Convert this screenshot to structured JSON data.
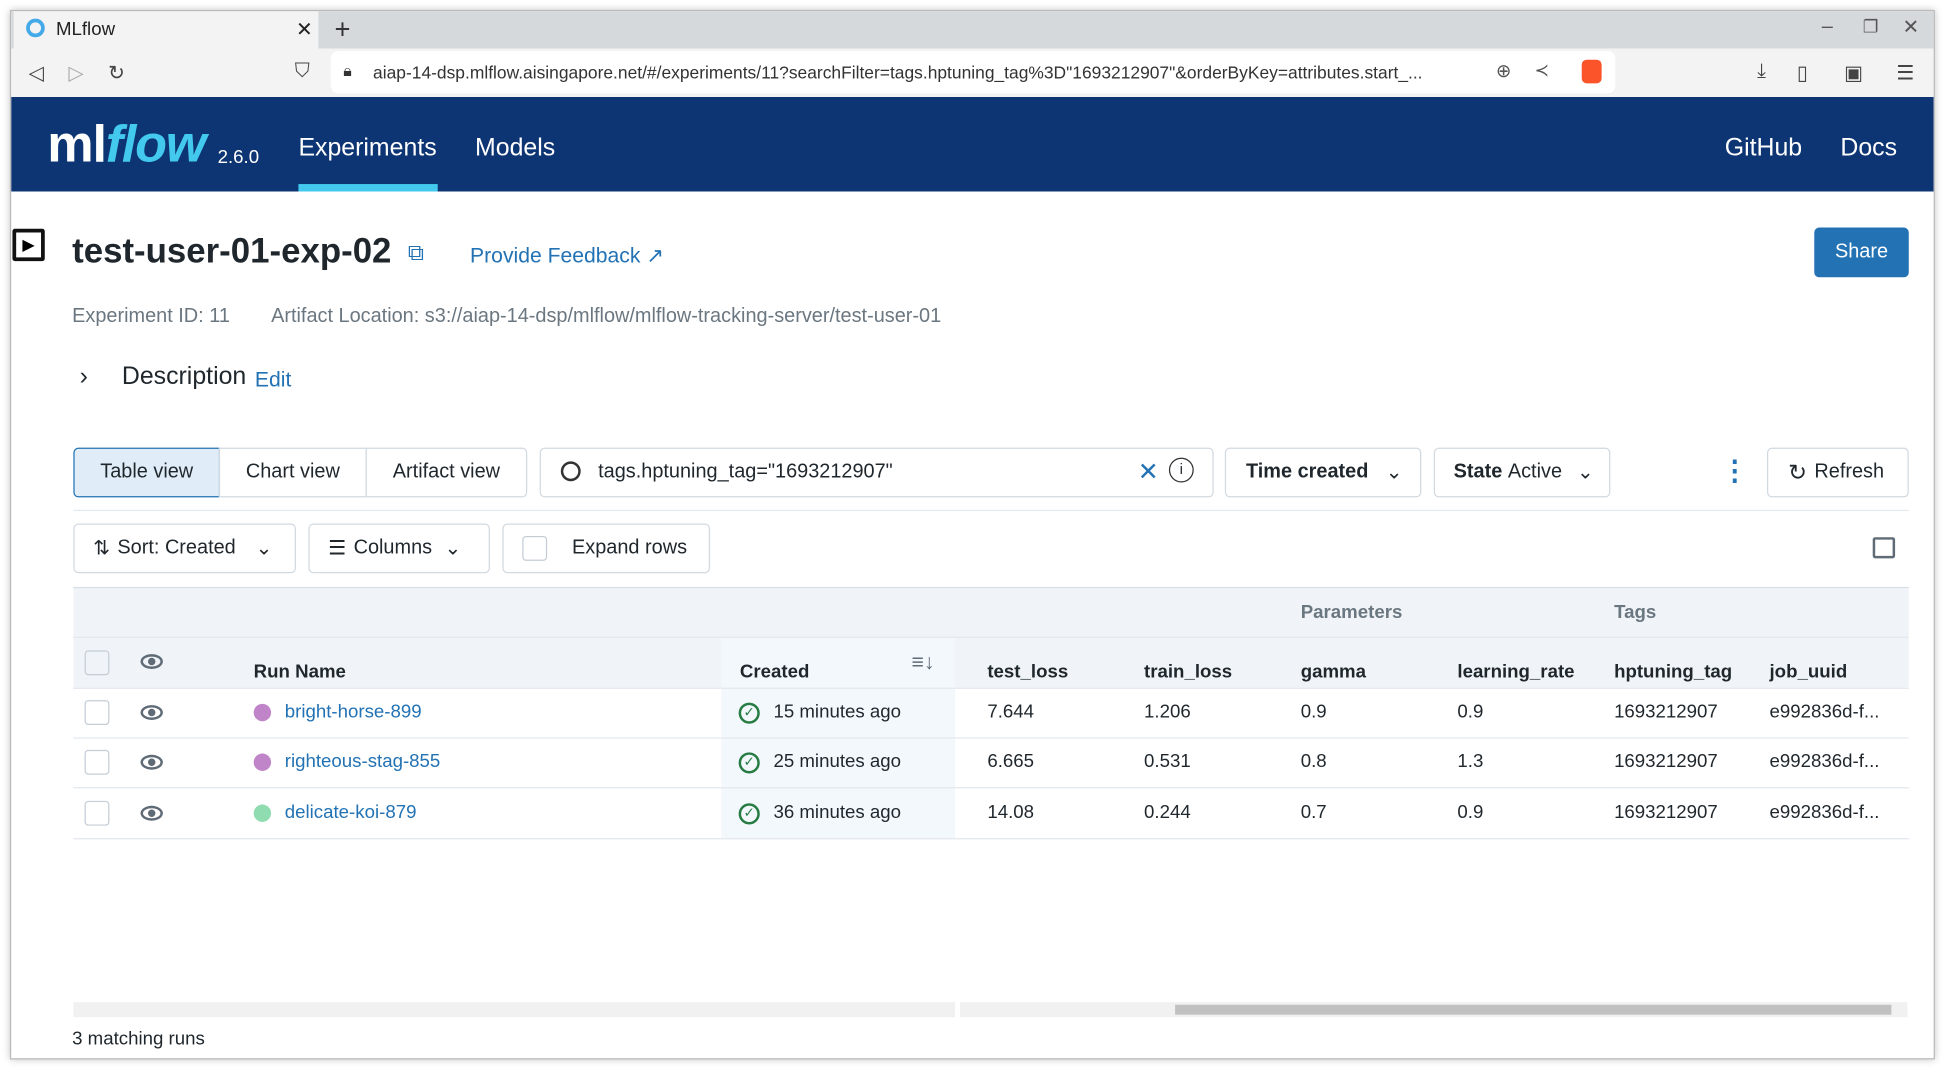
{
  "browser": {
    "tab_title": "MLflow",
    "url": "aiap-14-dsp.mlflow.aisingapore.net/#/experiments/11?searchFilter=tags.hptuning_tag%3D\"1693212907\"&orderByKey=attributes.start_..."
  },
  "nav": {
    "logo": "mlflow",
    "version": "2.6.0",
    "experiments": "Experiments",
    "models": "Models",
    "github": "GitHub",
    "docs": "Docs",
    "accent": "#43c9ed",
    "bg": "#0d3573"
  },
  "header": {
    "title": "test-user-01-exp-02",
    "feedback": "Provide Feedback",
    "share": "Share",
    "experiment_id": "Experiment ID: 11",
    "artifact_location": "Artifact Location: s3://aiap-14-dsp/mlflow/mlflow-tracking-server/test-user-01",
    "description": "Description",
    "edit": "Edit"
  },
  "controls": {
    "table_view": "Table view",
    "chart_view": "Chart view",
    "artifact_view": "Artifact view",
    "search_value": "tags.hptuning_tag=\"1693212907\"",
    "time_created": "Time created",
    "state_label": "State",
    "state_value": "Active",
    "refresh": "Refresh",
    "sort": "Sort: Created",
    "columns": "Columns",
    "expand_rows": "Expand rows"
  },
  "table": {
    "group_parameters": "Parameters",
    "group_tags": "Tags",
    "headers": {
      "run_name": "Run Name",
      "created": "Created",
      "test_loss": "test_loss",
      "train_loss": "train_loss",
      "gamma": "gamma",
      "learning_rate": "learning_rate",
      "hptuning_tag": "hptuning_tag",
      "job_uuid": "job_uuid"
    },
    "rows": [
      {
        "run_name": "bright-horse-899",
        "color": "#c084c8",
        "created": "15 minutes ago",
        "test_loss": "7.644",
        "train_loss": "1.206",
        "gamma": "0.9",
        "learning_rate": "0.9",
        "hptuning_tag": "1693212907",
        "job_uuid": "e992836d-f..."
      },
      {
        "run_name": "righteous-stag-855",
        "color": "#c084c8",
        "created": "25 minutes ago",
        "test_loss": "6.665",
        "train_loss": "0.531",
        "gamma": "0.8",
        "learning_rate": "1.3",
        "hptuning_tag": "1693212907",
        "job_uuid": "e992836d-f..."
      },
      {
        "run_name": "delicate-koi-879",
        "color": "#8fdcb0",
        "created": "36 minutes ago",
        "test_loss": "14.08",
        "train_loss": "0.244",
        "gamma": "0.7",
        "learning_rate": "0.9",
        "hptuning_tag": "1693212907",
        "job_uuid": "e992836d-f..."
      }
    ]
  },
  "footer": {
    "matching": "3 matching runs"
  }
}
